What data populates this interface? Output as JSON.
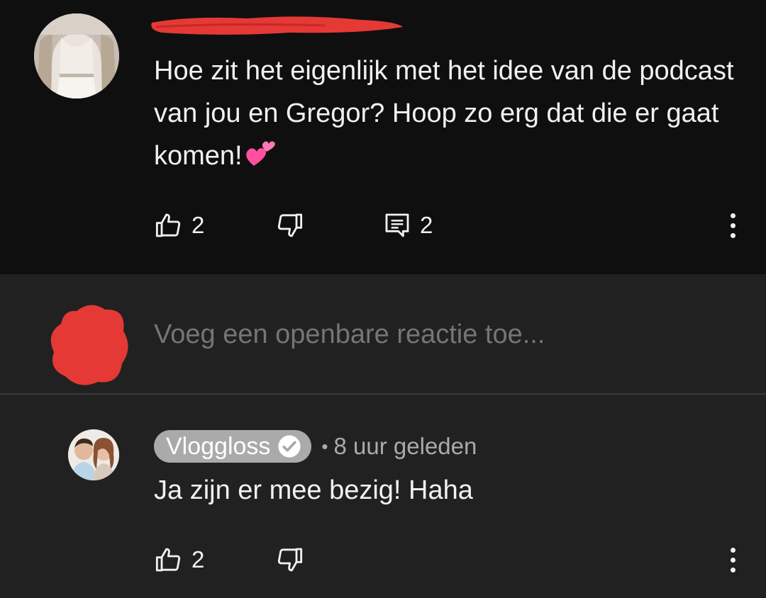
{
  "top_comment": {
    "text": "Hoe zit het eigenlijk met het idee van de podcast van jou en Gregor? Hoop zo erg dat die er gaat komen!",
    "emoji": "💕",
    "likes": "2",
    "replies": "2"
  },
  "reply_box": {
    "placeholder": "Voeg een openbare reactie toe..."
  },
  "reply": {
    "author": "Vloggloss",
    "separator": "•",
    "timestamp": "8 uur geleden",
    "text": "Ja zijn er mee bezig! Haha",
    "likes": "2"
  },
  "colors": {
    "top_background": "#0f0f0f",
    "page_background": "#212121",
    "secondary_text": "#aaaaaa",
    "redaction_red": "#e53935",
    "emoji_pink": "#ff4fa0"
  },
  "icons": [
    "thumb-up-icon",
    "thumb-down-icon",
    "comment-icon",
    "more-vert-icon",
    "verified-check-icon"
  ]
}
